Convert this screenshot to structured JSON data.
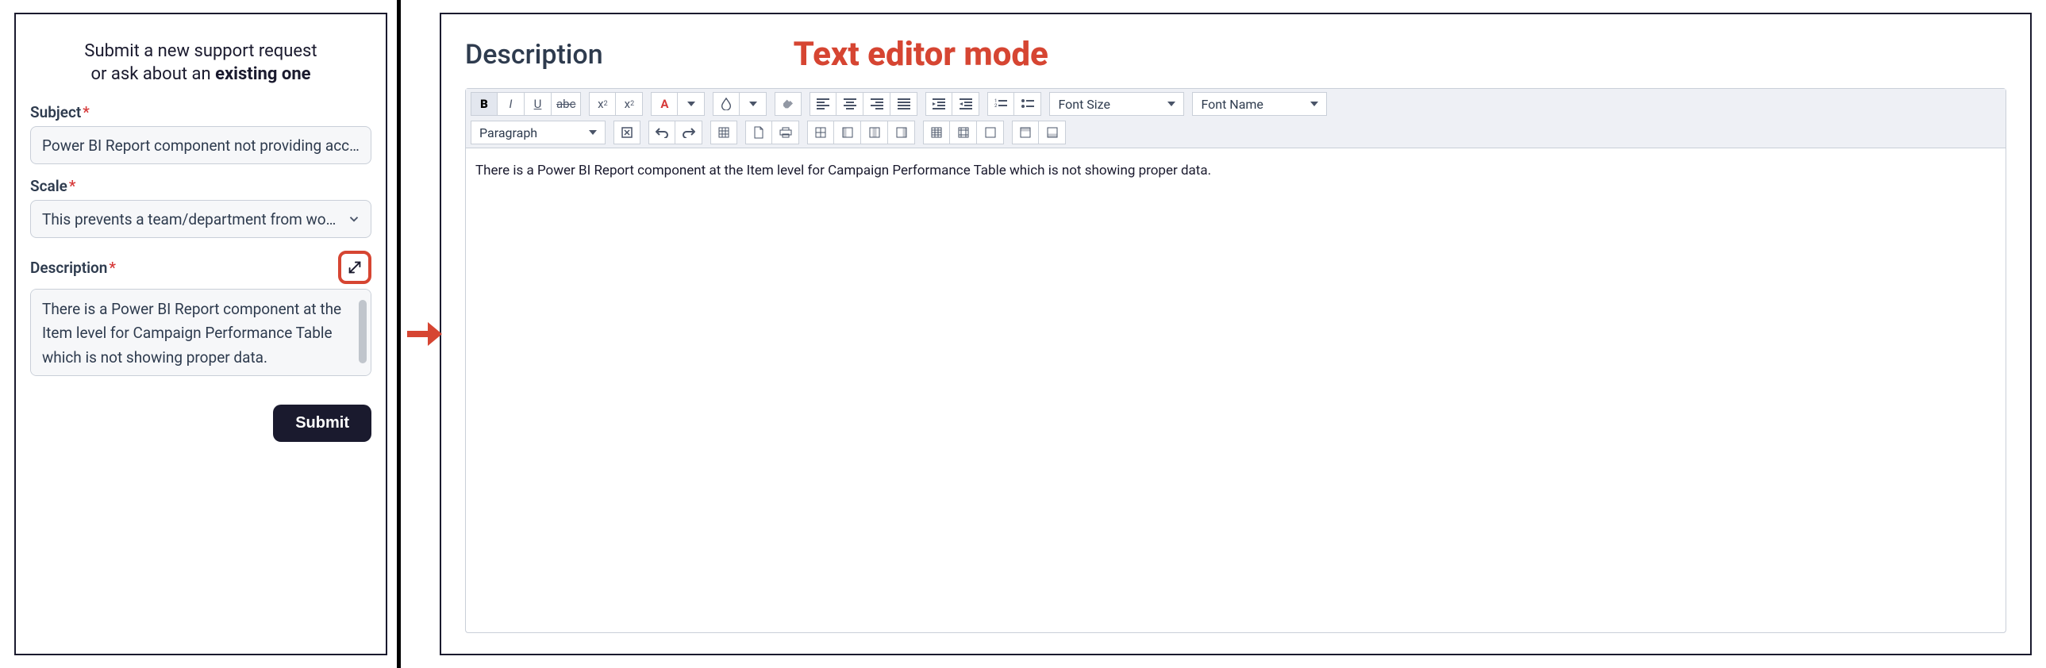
{
  "form": {
    "title_line1": "Submit a new support request",
    "title_line2_pre": "or ask about an ",
    "title_line2_bold": "existing one",
    "subject_label": "Subject",
    "subject_value": "Power BI Report component not providing accu…",
    "scale_label": "Scale",
    "scale_value": "This prevents a team/department from wor…",
    "description_label": "Description",
    "description_value": "There is a Power BI Report component at the Item level for Campaign Performance Table which is not showing proper data.",
    "submit_label": "Submit"
  },
  "annotation": {
    "mode_label": "Text editor mode"
  },
  "editor": {
    "label": "Description",
    "content": "There is a Power BI Report component at the Item level for Campaign Performance Table which is not showing proper data.",
    "font_size_label": "Font Size",
    "font_name_label": "Font Name",
    "paragraph_label": "Paragraph"
  }
}
